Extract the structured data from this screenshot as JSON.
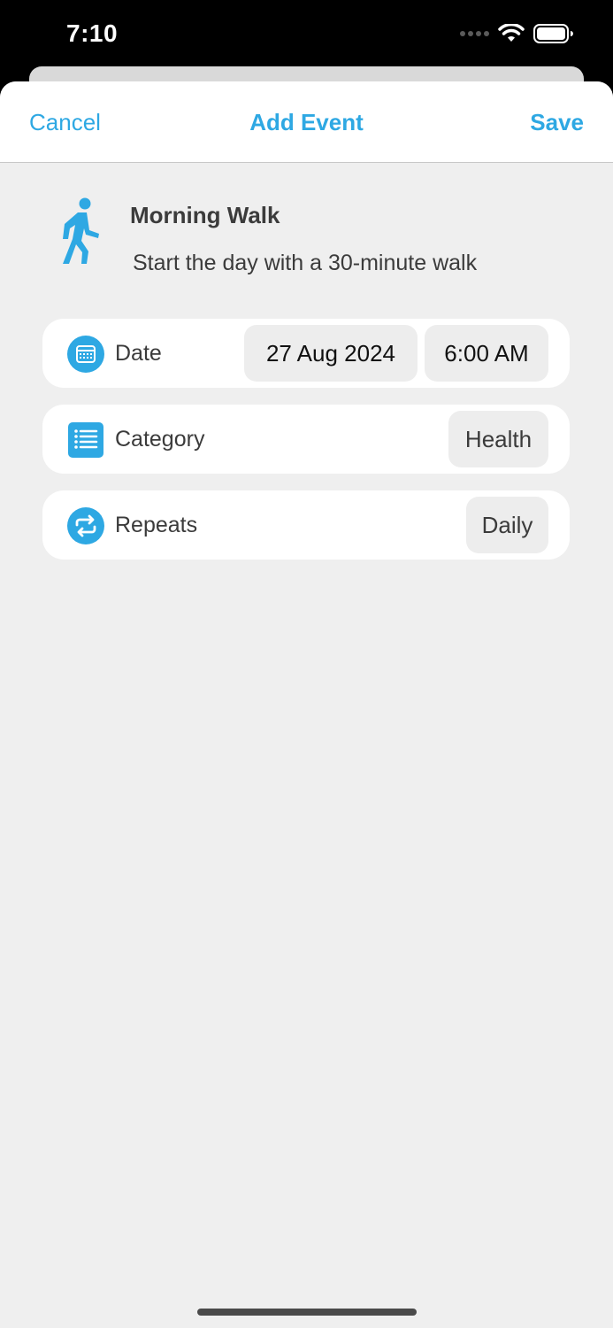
{
  "status_bar": {
    "time": "7:10"
  },
  "nav": {
    "cancel_label": "Cancel",
    "title": "Add Event",
    "save_label": "Save"
  },
  "event": {
    "icon": "walking-figure-icon",
    "title": "Morning Walk",
    "description": "Start the day with a 30-minute walk"
  },
  "rows": {
    "date": {
      "icon": "calendar-icon",
      "label": "Date",
      "date_value": "27 Aug 2024",
      "time_value": "6:00 AM"
    },
    "category": {
      "icon": "list-icon",
      "label": "Category",
      "value": "Health"
    },
    "repeats": {
      "icon": "repeat-icon",
      "label": "Repeats",
      "value": "Daily"
    }
  },
  "colors": {
    "accent": "#2ea8e3",
    "background": "#efefef",
    "card": "#ffffff",
    "pill": "#ededed"
  }
}
